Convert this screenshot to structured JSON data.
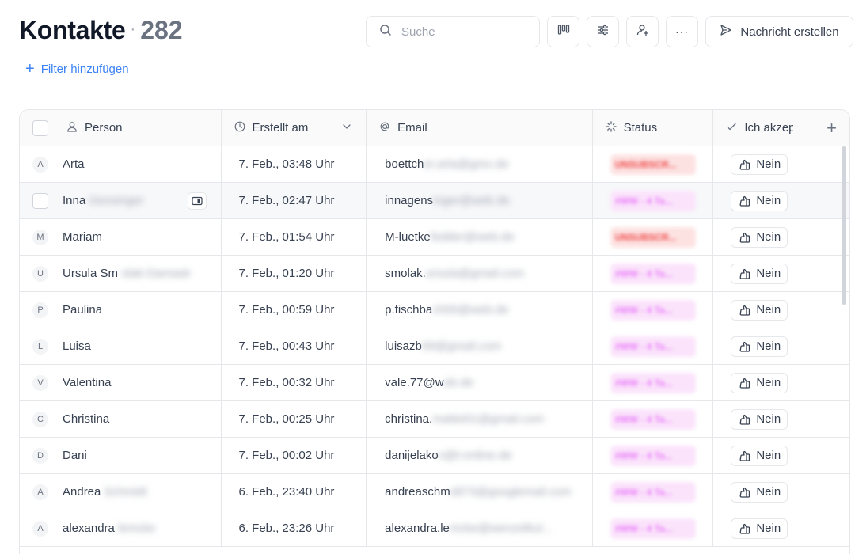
{
  "page": {
    "title": "Kontakte",
    "count": "282",
    "filter_label": "Filter hinzufügen"
  },
  "toolbar": {
    "search_placeholder": "Suche",
    "message_label": "Nachricht erstellen"
  },
  "table": {
    "columns": {
      "person": "Person",
      "created": "Erstellt am",
      "email": "Email",
      "status": "Status",
      "accept": "Ich akzeptiere"
    },
    "rows": [
      {
        "initial": "A",
        "first": "Arta",
        "last": "",
        "created": "7. Feb., 03:48 Uhr",
        "email_visible": "boettch",
        "email_hidden": "er.arta@gmx.de",
        "status": "UNSUBSCR...",
        "accept": "Nein"
      },
      {
        "initial": "",
        "first": "Inna",
        "last": "Gensinger",
        "created": "7. Feb., 02:47 Uhr",
        "email_visible": "innagens",
        "email_hidden": "inger@web.de",
        "status": "#WW - 4 Ta...",
        "accept": "Nein"
      },
      {
        "initial": "M",
        "first": "Mariam",
        "last": "",
        "created": "7. Feb., 01:54 Uhr",
        "email_visible": "M-luetke",
        "email_hidden": "fedder@web.de",
        "status": "UNSUBSCR...",
        "accept": "Nein"
      },
      {
        "initial": "U",
        "first": "Ursula Sm",
        "last": "olak-Damask",
        "created": "7. Feb., 01:20 Uhr",
        "email_visible": "smolak.",
        "email_hidden": "ursula@gmail.com",
        "status": "#WW - 4 Ta...",
        "accept": "Nein"
      },
      {
        "initial": "P",
        "first": "Paulina",
        "last": "",
        "created": "7. Feb., 00:59 Uhr",
        "email_visible": "p.fischba",
        "email_hidden": "ch00@web.de",
        "status": "#WW - 4 Ta...",
        "accept": "Nein"
      },
      {
        "initial": "L",
        "first": "Luisa",
        "last": "",
        "created": "7. Feb., 00:43 Uhr",
        "email_visible": "luisazb",
        "email_hidden": "69@gmail.com",
        "status": "#WW - 4 Ta...",
        "accept": "Nein"
      },
      {
        "initial": "V",
        "first": "Valentina",
        "last": "",
        "created": "7. Feb., 00:32 Uhr",
        "email_visible": "vale.77@w",
        "email_hidden": "eb.de",
        "status": "#WW - 4 Ta...",
        "accept": "Nein"
      },
      {
        "initial": "C",
        "first": "Christina",
        "last": "",
        "created": "7. Feb., 00:25 Uhr",
        "email_visible": "christina.",
        "email_hidden": "mattei01@gmail.com",
        "status": "#WW - 4 Ta...",
        "accept": "Nein"
      },
      {
        "initial": "D",
        "first": "Dani",
        "last": "",
        "created": "7. Feb., 00:02 Uhr",
        "email_visible": "danijelako",
        "email_hidden": "v@t-online.de",
        "status": "#WW - 4 Ta...",
        "accept": "Nein"
      },
      {
        "initial": "A",
        "first": "Andrea",
        "last": "Schmidt",
        "created": "6. Feb., 23:40 Uhr",
        "email_visible": "andreaschm",
        "email_hidden": "idt73@googlemail.com",
        "status": "#WW - 4 Ta...",
        "accept": "Nein"
      },
      {
        "initial": "A",
        "first": "alexandra",
        "last": "lemcke",
        "created": "6. Feb., 23:26 Uhr",
        "email_visible": "alexandra.le",
        "email_hidden": "mcke@wenzelkul...",
        "status": "#WW - 4 Ta...",
        "accept": "Nein"
      }
    ]
  },
  "colors": {
    "accent": "#3b82f6",
    "unsubscribed": "#ef4444",
    "ww_status": "#e879f9"
  }
}
